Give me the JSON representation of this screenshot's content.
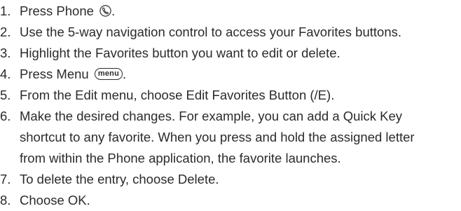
{
  "steps": [
    {
      "number": "1.",
      "parts": {
        "before": "Press Phone ",
        "after": "."
      },
      "icon": "phone-key-icon"
    },
    {
      "number": "2.",
      "lines": [
        "Use the 5-way navigation control to access your Favorites buttons."
      ]
    },
    {
      "number": "3.",
      "lines": [
        "Highlight the Favorites button you want to edit or delete."
      ]
    },
    {
      "number": "4.",
      "parts": {
        "before": "Press Menu ",
        "key_label": "menu",
        "after": "."
      },
      "icon": "menu-key-icon"
    },
    {
      "number": "5.",
      "lines": [
        "From the Edit menu, choose Edit Favorites Button (/E)."
      ]
    },
    {
      "number": "6.",
      "lines": [
        "Make the desired changes. For example, you can add a Quick Key",
        "shortcut to any favorite. When you press and hold the assigned letter",
        "from within the Phone application, the favorite launches."
      ]
    },
    {
      "number": "7.",
      "lines": [
        "To delete the entry, choose Delete."
      ]
    },
    {
      "number": "8.",
      "lines": [
        "Choose OK."
      ]
    }
  ]
}
